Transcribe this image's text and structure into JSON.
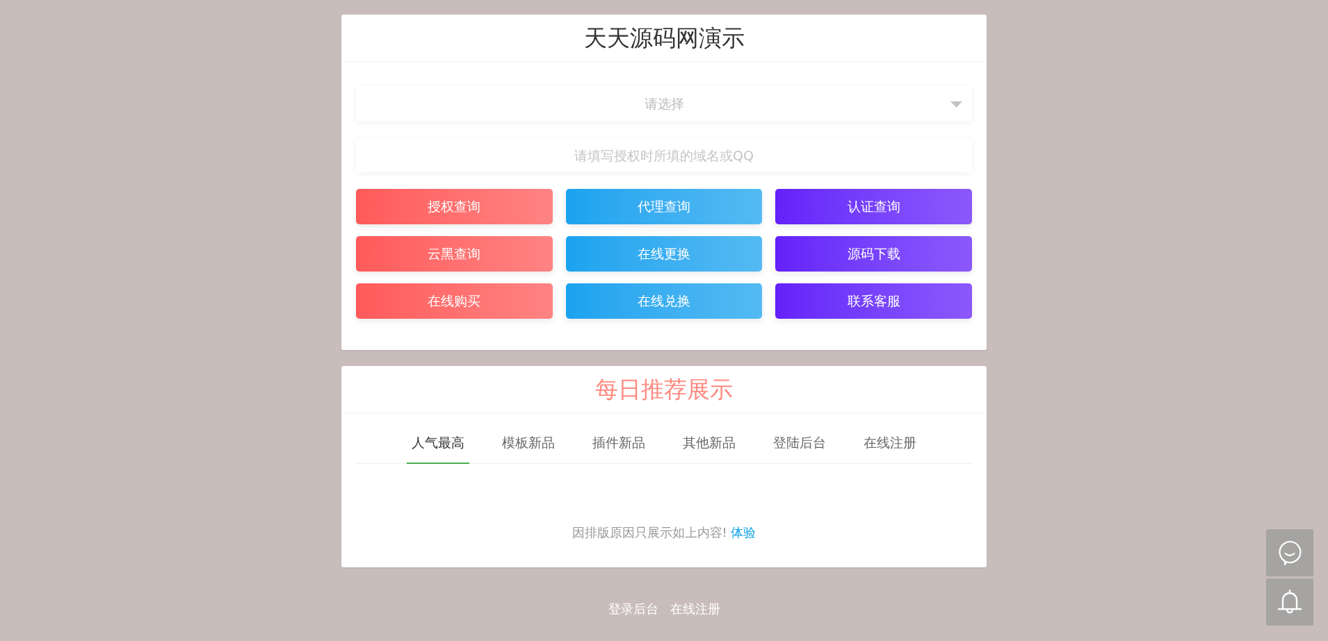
{
  "query_card": {
    "title": "天天源码网演示",
    "select": {
      "placeholder": "请选择"
    },
    "input": {
      "placeholder": "请填写授权时所填的域名或QQ"
    },
    "buttons": [
      {
        "label": "授权查询",
        "color": "#ff5a5a"
      },
      {
        "label": "代理查询",
        "color": "#1aa3ef"
      },
      {
        "label": "认证查询",
        "color": "#6520fa"
      },
      {
        "label": "云黑查询",
        "color": "#ff5a5a"
      },
      {
        "label": "在线更换",
        "color": "#1aa3ef"
      },
      {
        "label": "源码下载",
        "color": "#6520fa"
      },
      {
        "label": "在线购买",
        "color": "#ff5a5a"
      },
      {
        "label": "在线兑换",
        "color": "#1aa3ef"
      },
      {
        "label": "联系客服",
        "color": "#6520fa"
      }
    ]
  },
  "recommend_card": {
    "title": "每日推荐展示",
    "tabs": [
      {
        "label": "人气最高",
        "selected": true
      },
      {
        "label": "模板新品",
        "selected": false
      },
      {
        "label": "插件新品",
        "selected": false
      },
      {
        "label": "其他新品",
        "selected": false
      },
      {
        "label": "登陆后台",
        "selected": false
      },
      {
        "label": "在线注册",
        "selected": false
      }
    ],
    "notice": {
      "text": "因排版原因只展示如上内容!",
      "link": "体验"
    }
  },
  "footer_links": [
    "登录后台",
    "在线注册"
  ]
}
